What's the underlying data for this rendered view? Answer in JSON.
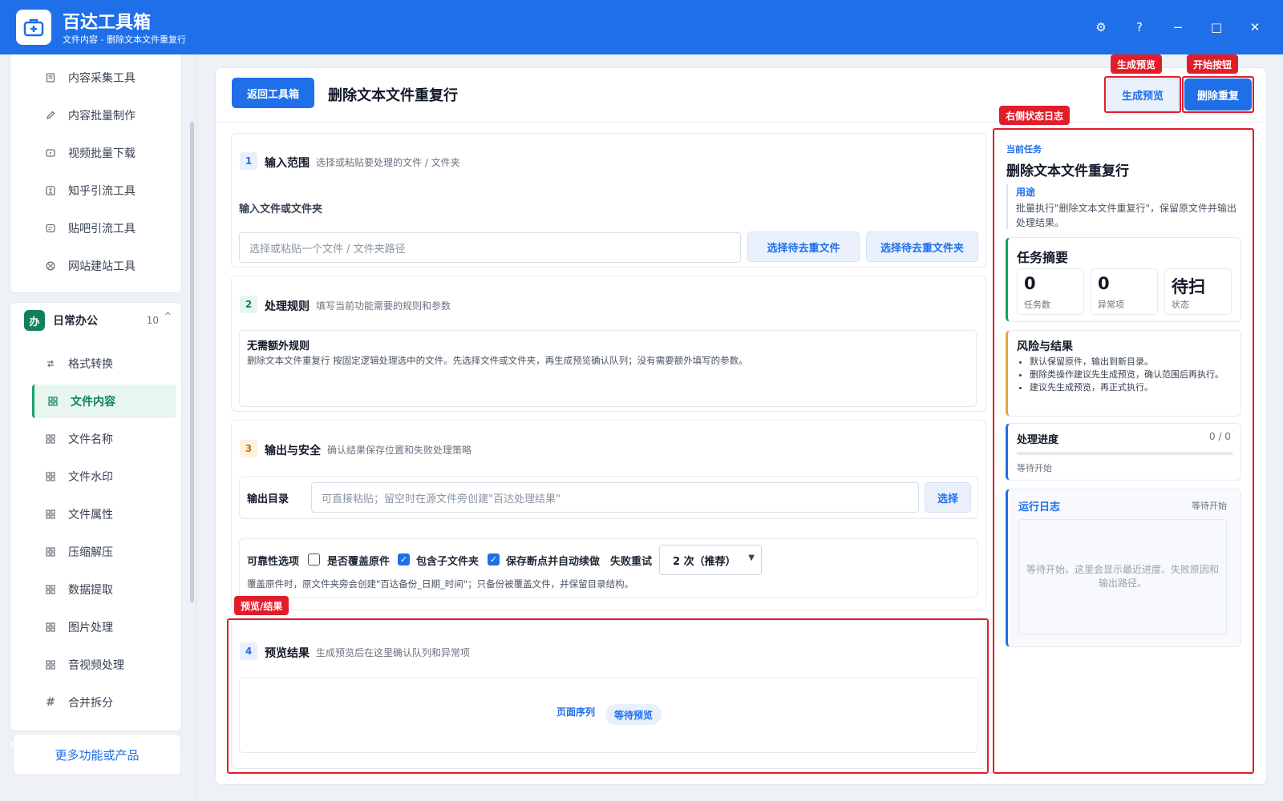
{
  "titlebar": {
    "title": "百达工具箱",
    "subtitle": "文件内容 - 删除文本文件重复行",
    "controls": [
      "⚙",
      "?",
      "−",
      "□",
      "✕"
    ]
  },
  "sidebar": {
    "top_items": [
      {
        "label": "内容采集工具",
        "icon": "document-icon"
      },
      {
        "label": "内容批量制作",
        "icon": "pen-icon"
      },
      {
        "label": "视频批量下载",
        "icon": "video-icon"
      },
      {
        "label": "知乎引流工具",
        "icon": "zhihu-icon"
      },
      {
        "label": "贴吧引流工具",
        "icon": "tieba-icon"
      },
      {
        "label": "网站建站工具",
        "icon": "globe-icon"
      }
    ],
    "group": {
      "badge": "办",
      "label": "日常办公",
      "count": "10",
      "caret": "^"
    },
    "group_items": [
      {
        "label": "格式转换",
        "icon": "swap-icon"
      },
      {
        "label": "文件内容",
        "icon": "grid-icon",
        "active": true
      },
      {
        "label": "文件名称",
        "icon": "grid-icon"
      },
      {
        "label": "文件水印",
        "icon": "grid-icon"
      },
      {
        "label": "文件属性",
        "icon": "grid-icon"
      },
      {
        "label": "压缩解压",
        "icon": "grid-icon"
      },
      {
        "label": "数据提取",
        "icon": "grid-icon"
      },
      {
        "label": "图片处理",
        "icon": "grid-icon"
      },
      {
        "label": "音视频处理",
        "icon": "grid-icon"
      },
      {
        "label": "合并拆分",
        "icon": "hash-icon"
      }
    ],
    "more_label": "更多功能或产品"
  },
  "header": {
    "back_label": "返回工具箱",
    "page_title": "删除文本文件重复行",
    "preview_label": "生成预览",
    "start_label": "删除重复"
  },
  "sections": {
    "s1": {
      "num": "1",
      "title": "输入范围",
      "desc": "选择或粘贴要处理的文件 / 文件夹",
      "field_label": "输入文件或文件夹",
      "placeholder": "选择或粘贴一个文件 / 文件夹路径",
      "btn_file": "选择待去重文件",
      "btn_folder": "选择待去重文件夹"
    },
    "s2": {
      "num": "2",
      "title": "处理规则",
      "desc": "填写当前功能需要的规则和参数",
      "rule_title": "无需额外规则",
      "rule_desc": "删除文本文件重复行 按固定逻辑处理选中的文件。先选择文件或文件夹，再生成预览确认队列；没有需要额外填写的参数。"
    },
    "s3": {
      "num": "3",
      "title": "输出与安全",
      "desc": "确认结果保存位置和失败处理策略",
      "output_label": "输出目录",
      "output_placeholder": "可直接粘贴；留空时在源文件旁创建\"百达处理结果\"",
      "select_btn": "选择",
      "reliability_label": "可靠性选项",
      "opt_overwrite": "是否覆盖原件",
      "opt_subfolders": "包含子文件夹",
      "opt_resume": "保存断点并自动续做",
      "retry_label": "失败重试",
      "retry_value": "2 次（推荐）",
      "note": "覆盖原件时，原文件夹旁会创建\"百达备份_日期_时间\"；只备份被覆盖文件，并保留目录结构。"
    },
    "s4": {
      "num": "4",
      "title": "预览结果",
      "desc": "生成预览后在这里确认队列和异常项",
      "queue_label": "页面序列",
      "status_pill": "等待预览"
    }
  },
  "right_panel": {
    "current_task_label": "当前任务",
    "task_title": "删除文本文件重复行",
    "purpose_label": "用途",
    "purpose_text": "批量执行\"删除文本文件重复行\"，保留原文件并输出处理结果。",
    "summary_title": "任务摘要",
    "metrics": [
      {
        "value": "0",
        "label": "任务数"
      },
      {
        "value": "0",
        "label": "异常项"
      },
      {
        "value": "待扫",
        "label": "状态"
      }
    ],
    "risk_title": "风险与结果",
    "risk_items": [
      "默认保留原件，输出到新目录。",
      "删除类操作建议先生成预览，确认范围后再执行。",
      "建议先生成预览，再正式执行。"
    ],
    "progress_title": "处理进度",
    "progress_value": "0 / 0",
    "progress_fraction": 0,
    "progress_status": "等待开始",
    "log_title": "运行日志",
    "log_status": "等待开始",
    "log_placeholder": "等待开始。这里会显示最近进度、失败原因和输出路径。"
  },
  "annotations": {
    "preview": "生成预览",
    "start": "开始按钮",
    "log": "右侧状态日志",
    "result": "预览/结果"
  },
  "colors": {
    "brand": "#1f6fe8",
    "active_green": "#12805a",
    "annotation_red": "#e11d2a"
  }
}
